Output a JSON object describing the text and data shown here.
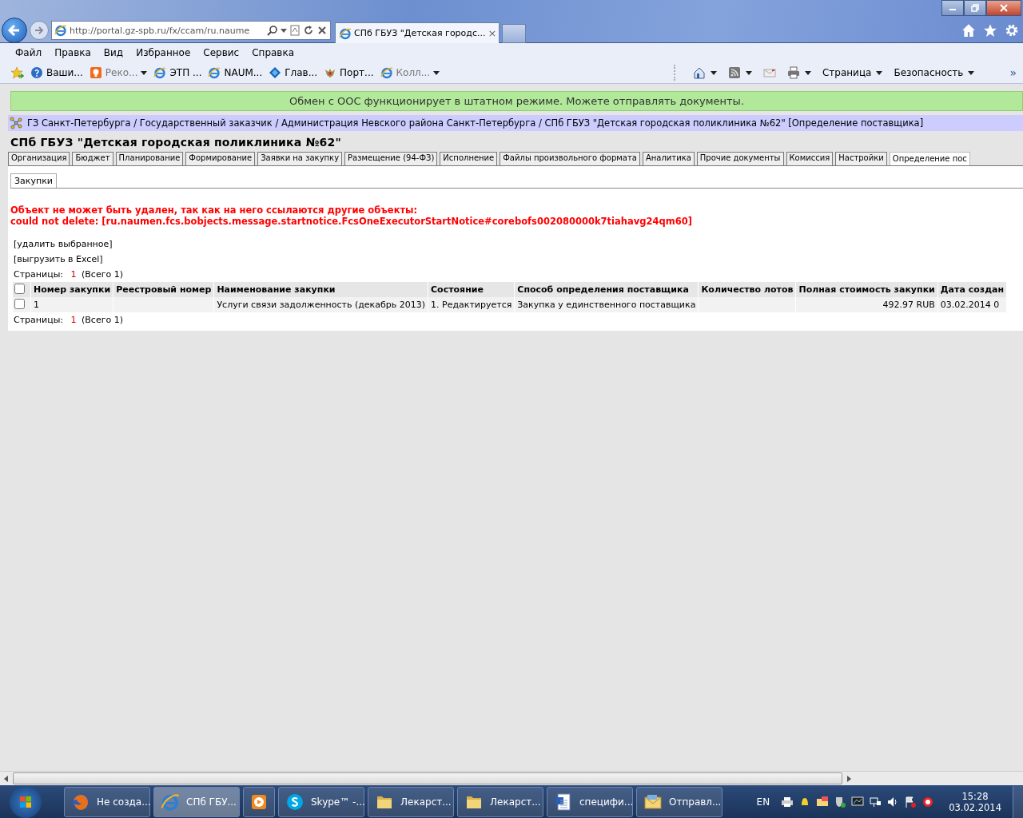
{
  "browser": {
    "address": "http://portal.gz-spb.ru/fx/ccam/ru.naume",
    "tabs": [
      {
        "title": "СПб ГБУЗ \"Детская городс...",
        "close": "×",
        "selected": true
      }
    ],
    "menu": [
      "Файл",
      "Правка",
      "Вид",
      "Избранное",
      "Сервис",
      "Справка"
    ],
    "favorites": [
      {
        "kind": "globe",
        "label": "Ваши...",
        "dimmed": false,
        "dropdown": false
      },
      {
        "kind": "bulb",
        "label": "Реко...",
        "dimmed": true,
        "dropdown": true
      },
      {
        "kind": "ie",
        "label": "ЭТП ...",
        "dimmed": false,
        "dropdown": false
      },
      {
        "kind": "ie",
        "label": "NAUM...",
        "dimmed": false,
        "dropdown": false
      },
      {
        "kind": "diamond",
        "label": "Глав...",
        "dimmed": false,
        "dropdown": false
      },
      {
        "kind": "emblem",
        "label": "Порт...",
        "dimmed": false,
        "dropdown": false
      },
      {
        "kind": "ie",
        "label": "Колл...",
        "dimmed": true,
        "dropdown": true
      }
    ],
    "commands": [
      {
        "kind": "home",
        "dropdown": true
      },
      {
        "kind": "feed",
        "dropdown": true
      },
      {
        "kind": "mail",
        "dropdown": false
      },
      {
        "kind": "print",
        "dropdown": true
      },
      {
        "kind": "text",
        "label": "Страница",
        "dropdown": true
      },
      {
        "kind": "text",
        "label": "Безопасность",
        "dropdown": true
      }
    ],
    "more": "»"
  },
  "page": {
    "banner": "Обмен с ООС функционирует в штатном режиме. Можете отправлять документы.",
    "breadcrumb": "ГЗ Санкт-Петербурга / Государственный заказчик / Администрация Невского района Санкт-Петербурга / СПб ГБУЗ \"Детская городская поликлиника №62\" [Определение поставщика]",
    "title": "СПб ГБУЗ \"Детская городская поликлиника №62\"",
    "tabs": [
      {
        "label": "Организация",
        "selected": false
      },
      {
        "label": "Бюджет",
        "selected": false
      },
      {
        "label": "Планирование",
        "selected": false
      },
      {
        "label": "Формирование",
        "selected": false
      },
      {
        "label": "Заявки на закупку",
        "selected": false
      },
      {
        "label": "Размещение (94-ФЗ)",
        "selected": false
      },
      {
        "label": "Исполнение",
        "selected": false
      },
      {
        "label": "Файлы произвольного формата",
        "selected": false
      },
      {
        "label": "Аналитика",
        "selected": false
      },
      {
        "label": "Прочие документы",
        "selected": false
      },
      {
        "label": "Комиссия",
        "selected": false
      },
      {
        "label": "Настройки",
        "selected": false
      },
      {
        "label": "Определение пос",
        "selected": true
      }
    ],
    "subtabs": [
      {
        "label": "Закупки",
        "selected": true
      }
    ],
    "error": [
      "Объект не может быть удален, так как на него ссылаются другие объекты:",
      "could not delete: [ru.naumen.fcs.bobjects.message.startnotice.FcsOneExecutorStartNotice#corebofs002080000k7tiahavg24qm60]"
    ],
    "actions": [
      "[удалить выбранное]",
      "[выгрузить в Excel]"
    ],
    "pager_top": {
      "label": "Страницы:",
      "current": "1",
      "total": "(Всего 1)"
    },
    "table": {
      "select_all_checked": false,
      "columns": [
        "Номер закупки",
        "Реестровый номер",
        "Наименование закупки",
        "Состояние",
        "Способ определения поставщика",
        "Количество лотов",
        "Полная стоимость закупки",
        "Дата создан"
      ],
      "rows": [
        {
          "checked": false,
          "cells": [
            "1",
            null,
            "Услуги связи задолженность (декабрь 2013)",
            "1. Редактируется",
            "Закупка у единственного поставщика",
            null,
            "492.97 RUB",
            "03.02.2014 0"
          ]
        }
      ]
    },
    "pager_bottom": {
      "label": "Страницы:",
      "current": "1",
      "total": "(Всего 1)"
    }
  },
  "taskbar": {
    "items": [
      {
        "kind": "firefox",
        "label": "Не созда...",
        "selected": false
      },
      {
        "kind": "ie",
        "label": "СПб ГБУ...",
        "selected": true
      },
      {
        "kind": "media",
        "selected": false
      },
      {
        "kind": "skype",
        "label": "Skype™ -...",
        "selected": false
      },
      {
        "kind": "folder",
        "label": "Лекарст...",
        "selected": false
      },
      {
        "kind": "folder",
        "label": "Лекарст...",
        "selected": false
      },
      {
        "kind": "word",
        "label": "специфи...",
        "selected": false
      },
      {
        "kind": "outlook",
        "label": "Отправл...",
        "selected": false
      }
    ],
    "language": "EN",
    "time": "15:28",
    "date": "03.02.2014"
  }
}
